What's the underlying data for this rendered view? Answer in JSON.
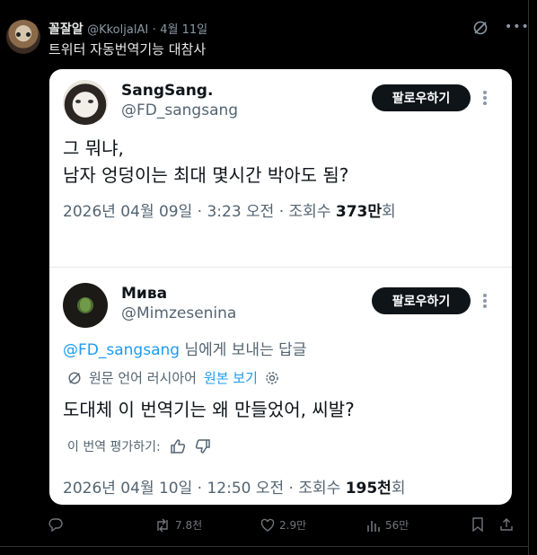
{
  "post": {
    "author_name": "꼴잘알",
    "author_handle": "@KkoljalAI",
    "separator": "·",
    "date": "4월 11일",
    "text": "트위터 자동번역기능 대참사",
    "icons": {
      "grok": "grok-icon",
      "more": "more-icon"
    }
  },
  "card": {
    "tweet1": {
      "name": "SangSang.",
      "handle": "@FD_sangsang",
      "follow_label": "팔로우하기",
      "lines": [
        "그 뭐냐,",
        "남자 엉덩이는 최대 몇시간 박아도 됨?"
      ],
      "datetime": "2026년 04월 09일 · 3:23 오전 · 조회수 ",
      "views": "373만",
      "views_suffix": "회"
    },
    "tweet2": {
      "name": "Мива",
      "handle": "@Mimzesenina",
      "follow_label": "팔로우하기",
      "reply_mention": "@FD_sangsang",
      "reply_suffix": " 님에게 보내는 답글",
      "translated_label": "원문 언어 러시아어",
      "show_original": "원본 보기",
      "text": "도대체 이 번역기는 왜 만들었어, 씨발?",
      "rate_label": "이 번역 평가하기:",
      "datetime": "2026년 04월 10일 · 12:50 오전 · 조회수 ",
      "views": "195천",
      "views_suffix": "회"
    }
  },
  "actions": {
    "retweets": "7.8천",
    "likes": "2.9만",
    "views": "56만"
  },
  "colors": {
    "accent": "#1d9bf0",
    "background": "#000000",
    "card": "#ffffff",
    "muted": "#71767b"
  }
}
